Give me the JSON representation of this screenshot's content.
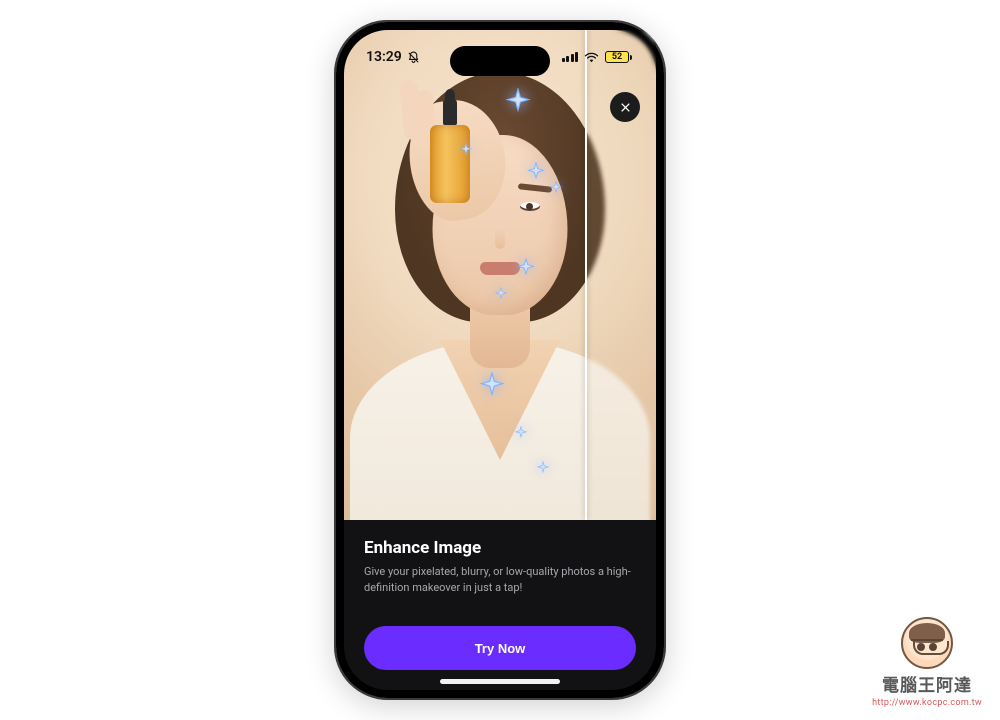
{
  "status": {
    "time": "13:29",
    "battery_text": "52"
  },
  "feature": {
    "title": "Enhance Image",
    "subtitle": "Give your pixelated, blurry, or low-quality photos a high-definition makeover in just a tap!"
  },
  "cta": {
    "label": "Try Now"
  },
  "watermark": {
    "text": "電腦王阿達",
    "url": "http://www.kocpc.com.tw"
  }
}
